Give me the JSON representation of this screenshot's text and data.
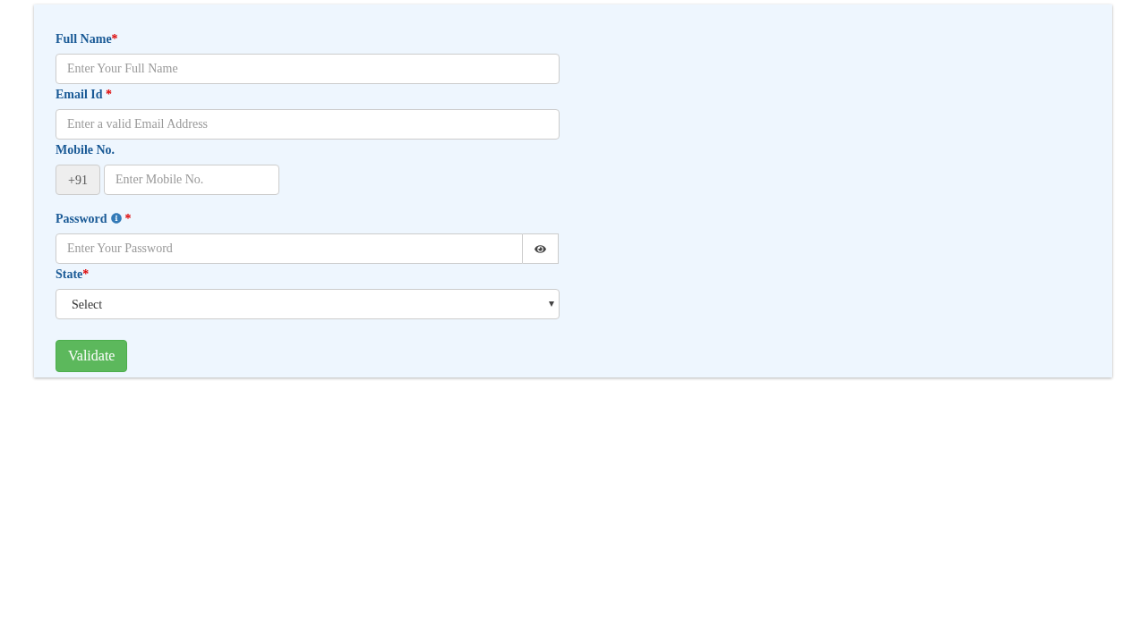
{
  "fields": [
    {
      "kind": "text",
      "label": "Full Name",
      "mark": "*",
      "info_icon": false,
      "placeholder": "Enter Your Full Name"
    },
    {
      "kind": "text",
      "label": "Email Id",
      "mark": " *",
      "info_icon": false,
      "placeholder": "Enter a valid Email Address"
    },
    {
      "kind": "phone",
      "label": "Mobile No.",
      "prefix": "+91",
      "placeholder": "Enter Mobile No.",
      "info_icon": false
    },
    {
      "kind": "password",
      "label": "Password",
      "mark": "*",
      "info_icon": true,
      "placeholder": "Enter Your Password"
    },
    {
      "kind": "select",
      "label": "State",
      "mark": "*",
      "info_icon": false,
      "value": "Select"
    }
  ],
  "button": "Validate"
}
